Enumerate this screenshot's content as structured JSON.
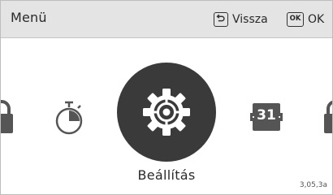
{
  "header": {
    "title": "Menü",
    "back_label": "Vissza",
    "ok_key": "OK",
    "ok_label": "OK"
  },
  "menu": {
    "selected_label": "Beállítás",
    "calendar_day": "31",
    "items": [
      {
        "icon": "lock-icon",
        "position": "far-left"
      },
      {
        "icon": "timer-icon",
        "position": "left"
      },
      {
        "icon": "gear-icon",
        "position": "center",
        "selected": true
      },
      {
        "icon": "calendar-icon",
        "position": "right"
      },
      {
        "icon": "lock-icon",
        "position": "far-right"
      }
    ]
  },
  "footer": {
    "version": "3,05,3a"
  },
  "colors": {
    "header_bg": "#e4e4e4",
    "selected_bg": "#3a3a3a",
    "icon_gray": "#555555"
  }
}
